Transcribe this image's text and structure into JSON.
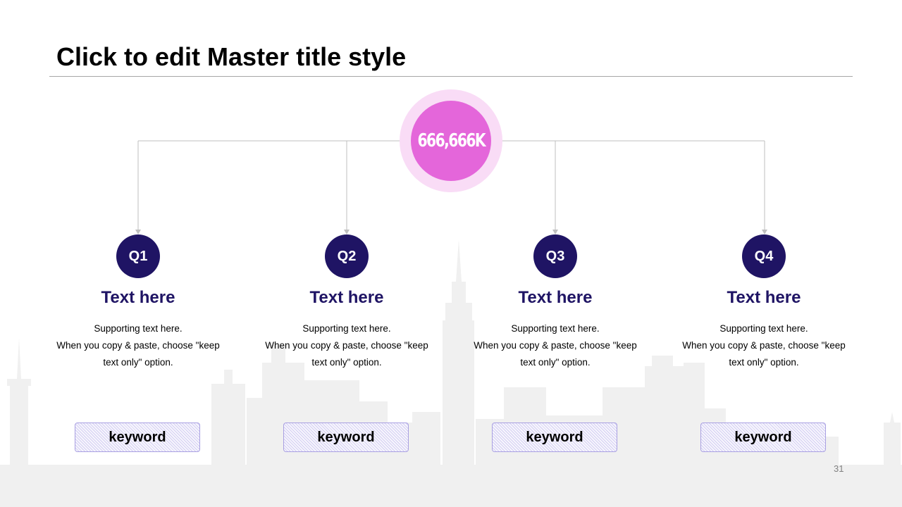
{
  "slide": {
    "title": "Click to edit Master title style",
    "page_number": "31"
  },
  "hub": {
    "value": "666,666K"
  },
  "columns": [
    {
      "badge": "Q1",
      "heading": "Text here",
      "body_line1": "Supporting  text here.",
      "body_line2": "When  you copy & paste, choose \"keep",
      "body_line3": "text only\" option.",
      "keyword": "keyword"
    },
    {
      "badge": "Q2",
      "heading": "Text here",
      "body_line1": "Supporting  text here.",
      "body_line2": "When  you copy & paste, choose \"keep",
      "body_line3": "text only\" option.",
      "keyword": "keyword"
    },
    {
      "badge": "Q3",
      "heading": "Text here",
      "body_line1": "Supporting  text here.",
      "body_line2": "When  you copy & paste, choose \"keep",
      "body_line3": "text only\" option.",
      "keyword": "keyword"
    },
    {
      "badge": "Q4",
      "heading": "Text here",
      "body_line1": "Supporting  text here.",
      "body_line2": "When  you copy & paste, choose \"keep",
      "body_line3": "text only\" option.",
      "keyword": "keyword"
    }
  ],
  "colors": {
    "badge": "#1f1464",
    "heading": "#1f1464",
    "hub_inner": "#e466da",
    "hub_outer": "#f9dcf6",
    "skyline": "#f0f0f0",
    "connector": "#bfbfbf"
  }
}
